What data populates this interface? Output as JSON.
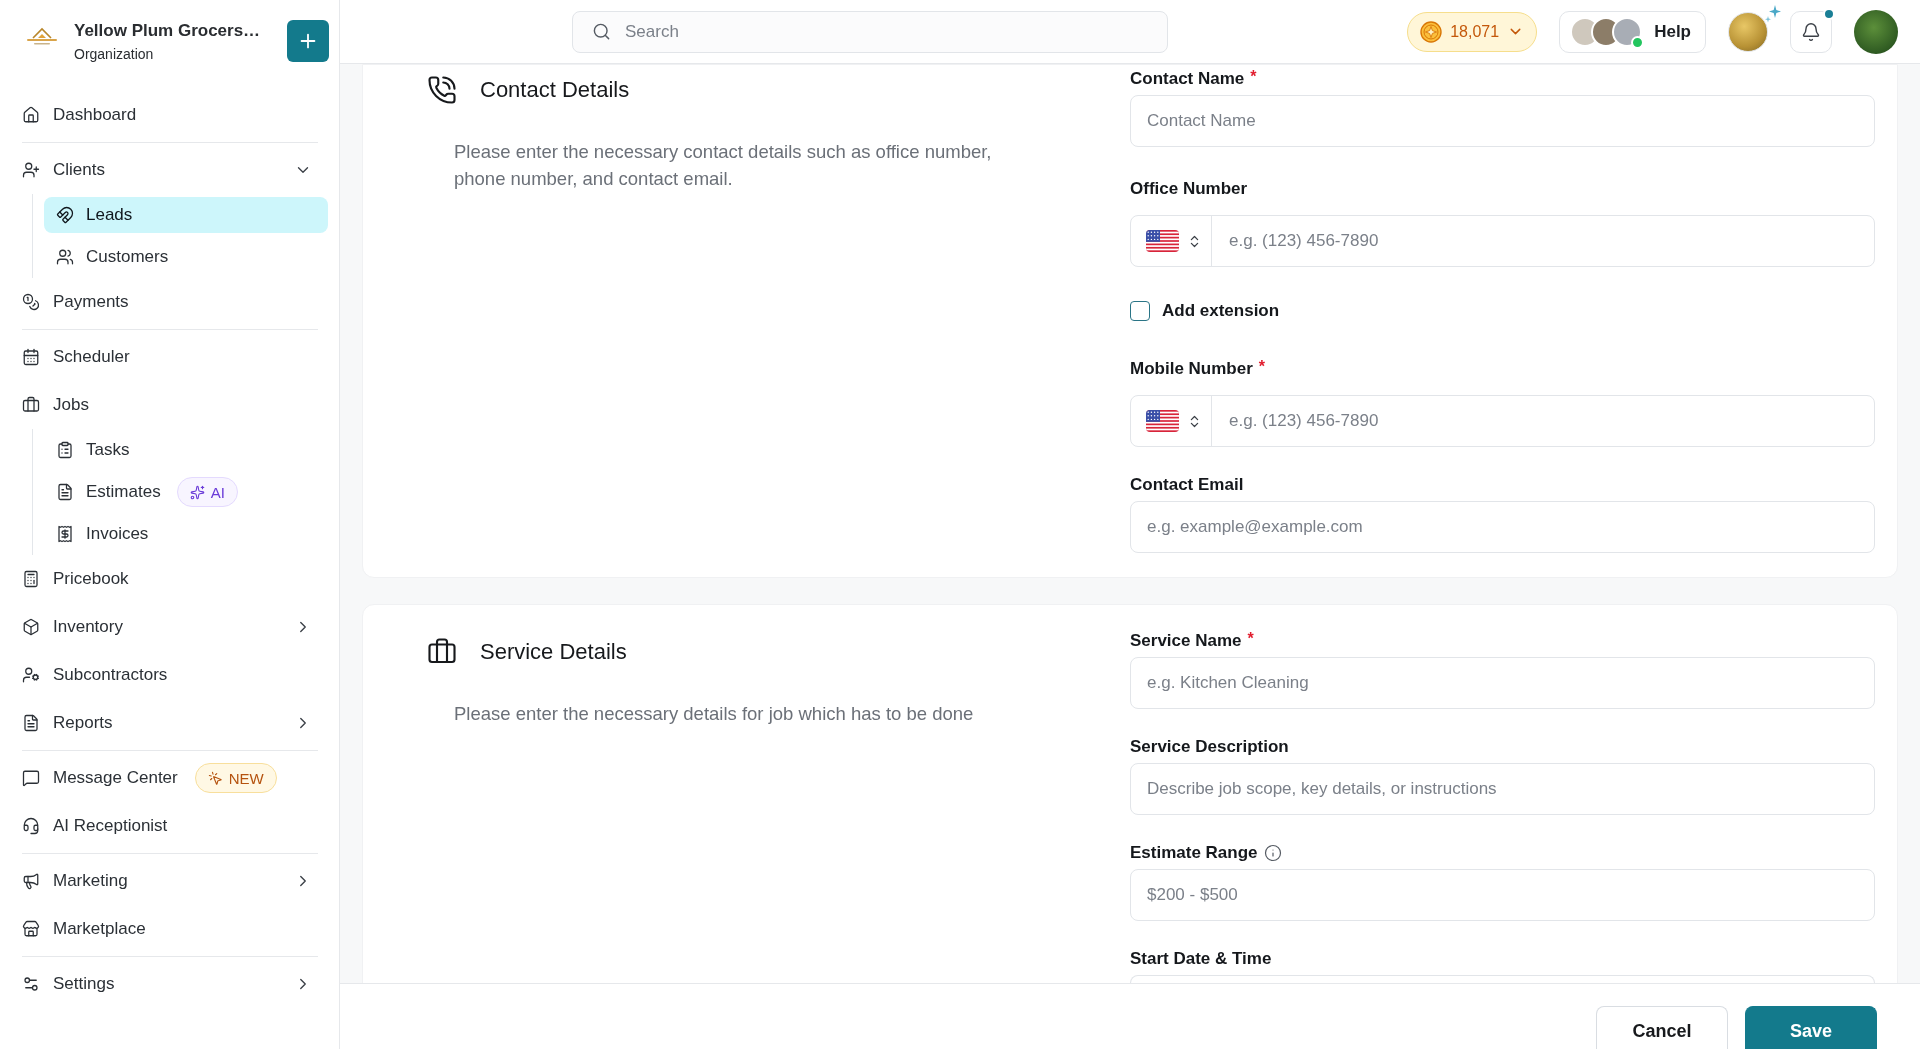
{
  "organization": {
    "name": "Yellow Plum Grocers…",
    "subtitle": "Organization"
  },
  "sidebar": {
    "groups": [
      {
        "items": [
          {
            "label": "Dashboard",
            "selected": false
          }
        ]
      },
      {
        "items": [
          {
            "label": "Clients",
            "selected": false,
            "expanded": true,
            "children": [
              {
                "label": "Leads",
                "selected": true
              },
              {
                "label": "Customers",
                "selected": false
              }
            ]
          },
          {
            "label": "Payments",
            "selected": false
          }
        ]
      },
      {
        "items": [
          {
            "label": "Scheduler",
            "selected": false
          },
          {
            "label": "Jobs",
            "selected": false,
            "children": [
              {
                "label": "Tasks",
                "selected": false
              },
              {
                "label": "Estimates",
                "selected": false,
                "badge": {
                  "kind": "ai",
                  "text": "AI"
                }
              },
              {
                "label": "Invoices",
                "selected": false
              }
            ]
          },
          {
            "label": "Pricebook",
            "selected": false
          },
          {
            "label": "Inventory",
            "selected": false,
            "expanded": false
          },
          {
            "label": "Subcontractors",
            "selected": false
          },
          {
            "label": "Reports",
            "selected": false,
            "expanded": false
          }
        ]
      },
      {
        "items": [
          {
            "label": "Message Center",
            "selected": false,
            "badge": {
              "kind": "new",
              "text": "NEW"
            }
          },
          {
            "label": "AI Receptionist",
            "selected": false
          }
        ]
      },
      {
        "items": [
          {
            "label": "Marketing",
            "selected": false,
            "expanded": false
          },
          {
            "label": "Marketplace",
            "selected": false
          }
        ]
      },
      {
        "items": [
          {
            "label": "Settings",
            "selected": false,
            "expanded": false
          }
        ]
      }
    ]
  },
  "header": {
    "search": {
      "placeholder": "Search"
    },
    "credits": {
      "value": "18,071"
    },
    "help": {
      "label": "Help",
      "online": true
    },
    "notifications": {
      "unread": true
    }
  },
  "sections": [
    {
      "title": "Contact Details",
      "description": "Please enter the necessary contact details such as office number, phone number, and contact email.",
      "fields": [
        {
          "kind": "text",
          "label": "Contact Name",
          "required_mark": "*",
          "placeholder": "Contact Name"
        },
        {
          "kind": "phone",
          "label": "Office Number",
          "placeholder": "e.g. (123) 456-7890"
        },
        {
          "kind": "checkbox",
          "label": "Add extension",
          "checked": false
        },
        {
          "kind": "phone",
          "label": "Mobile Number",
          "required_mark": "*",
          "placeholder": "e.g. (123) 456-7890"
        },
        {
          "kind": "text",
          "label": "Contact Email",
          "placeholder": "e.g. example@example.com"
        }
      ]
    },
    {
      "title": "Service Details",
      "description": "Please enter the necessary details for job which has to be done",
      "fields": [
        {
          "kind": "text",
          "label": "Service Name",
          "required_mark": "*",
          "placeholder": "e.g. Kitchen Cleaning"
        },
        {
          "kind": "text",
          "label": "Service Description",
          "placeholder": "Describe job scope, key details, or instructions"
        },
        {
          "kind": "text",
          "label": "Estimate Range",
          "info": true,
          "placeholder": "$200 - $500"
        },
        {
          "kind": "date",
          "label": "Start Date & Time"
        }
      ]
    }
  ],
  "footer": {
    "buttons": [
      {
        "label": "Cancel",
        "kind": "secondary"
      },
      {
        "label": "Save",
        "kind": "primary"
      }
    ]
  }
}
